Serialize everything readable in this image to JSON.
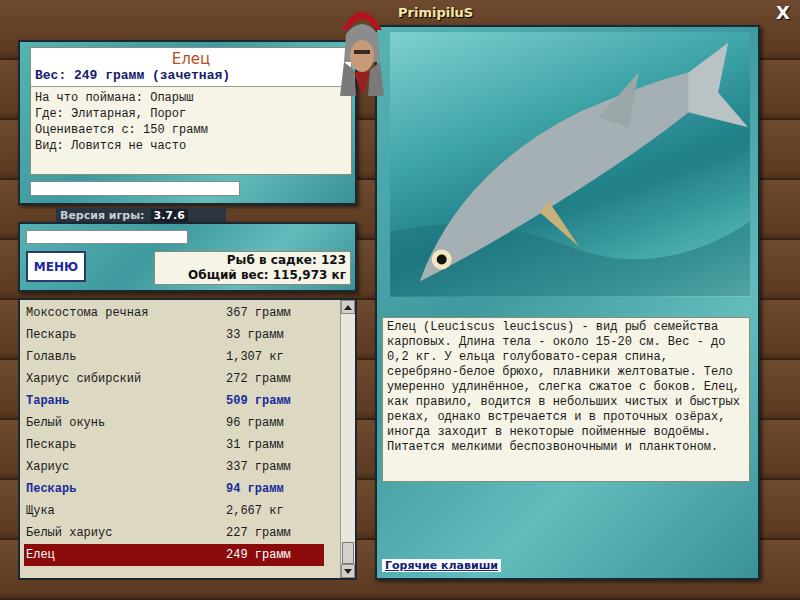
{
  "player": {
    "name": "PrimipiluS"
  },
  "close": "X",
  "catch": {
    "name": "Елец",
    "weight": "Вес: 249 грамм (зачетная)",
    "details": [
      "На что поймана: Опарыш",
      "Где: Элитарная, Порог",
      "Оценивается с: 150 грамм",
      "Вид: Ловится не часто"
    ]
  },
  "version": {
    "label": "Версия игры:",
    "value": "3.7.6"
  },
  "menu_button": "МЕНЮ",
  "keepnet": {
    "count": "Рыб в садке: 123",
    "total": "Общий вес: 115,973 кг"
  },
  "fish_list": [
    {
      "name": "Моксостома речная",
      "weight": "367 грамм",
      "highlighted": false,
      "selected": false
    },
    {
      "name": "Пескарь",
      "weight": "33 грамм",
      "highlighted": false,
      "selected": false
    },
    {
      "name": "Голавль",
      "weight": "1,307 кг",
      "highlighted": false,
      "selected": false
    },
    {
      "name": "Хариус сибирский",
      "weight": "272 грамм",
      "highlighted": false,
      "selected": false
    },
    {
      "name": "Тарань",
      "weight": "509 грамм",
      "highlighted": true,
      "selected": false
    },
    {
      "name": "Белый окунь",
      "weight": "96 грамм",
      "highlighted": false,
      "selected": false
    },
    {
      "name": "Пескарь",
      "weight": "31 грамм",
      "highlighted": false,
      "selected": false
    },
    {
      "name": "Хариус",
      "weight": "337 грамм",
      "highlighted": false,
      "selected": false
    },
    {
      "name": "Пескарь",
      "weight": "94 грамм",
      "highlighted": true,
      "selected": false
    },
    {
      "name": "Щука",
      "weight": "2,667 кг",
      "highlighted": false,
      "selected": false
    },
    {
      "name": "Белый хариус",
      "weight": "227 грамм",
      "highlighted": false,
      "selected": false
    },
    {
      "name": "Елец",
      "weight": "249 грамм",
      "highlighted": false,
      "selected": true
    }
  ],
  "list_scroll": {
    "position": 1
  },
  "description": "Елец (Leuciscus leuciscus) - вид рыб семейства карповых. Длина тела - около 15-20 см. Вес - до 0,2 кг. У ельца голубовато-серая спина, серебряно-белое брюхо, плавники желтоватые. Тело умеренно удлинённое, слегка сжатое с боков. Елец, как правило, водится в небольших чистых и быстрых реках, однако встречается и в проточных озёрах, иногда заходит в некоторые пойменные водоёмы. Питается мелкими беспозвоночными и планктоном.",
  "hotkeys_link": "Горячие клавиши"
}
